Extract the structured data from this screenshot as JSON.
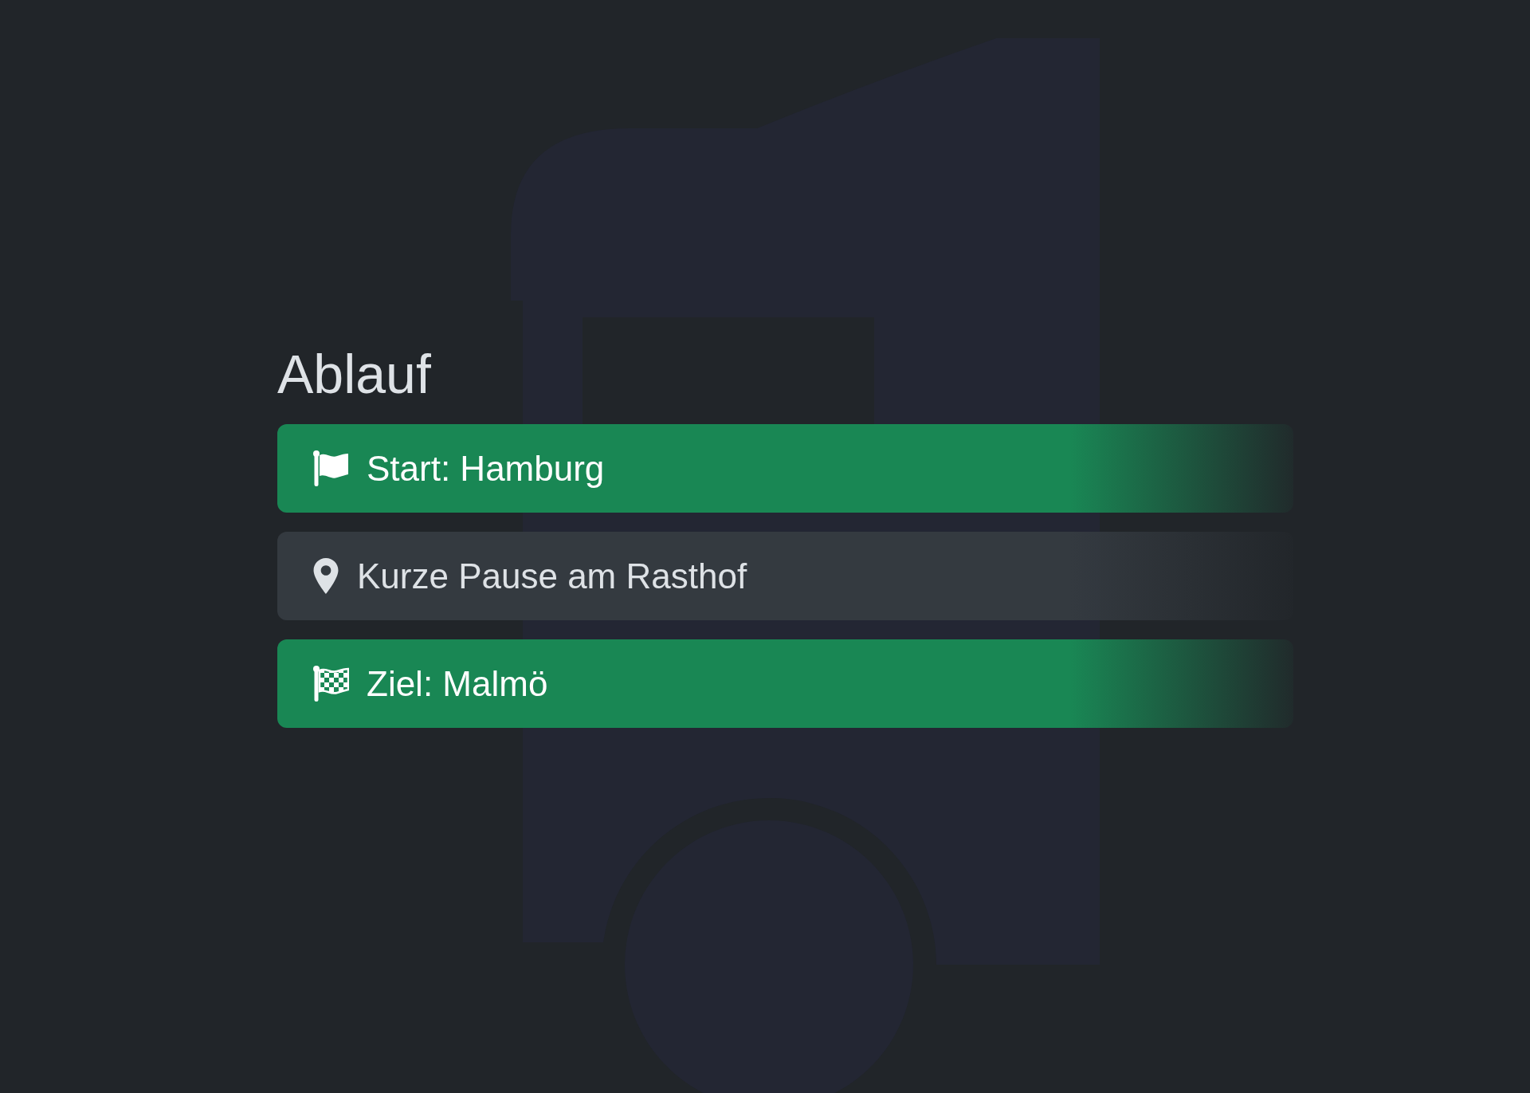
{
  "heading": "Ablauf",
  "steps": [
    {
      "kind": "start",
      "label": "Start: Hamburg"
    },
    {
      "kind": "stop",
      "label": "Kurze Pause am Rasthof"
    },
    {
      "kind": "finish",
      "label": "Ziel: Malmö"
    }
  ]
}
